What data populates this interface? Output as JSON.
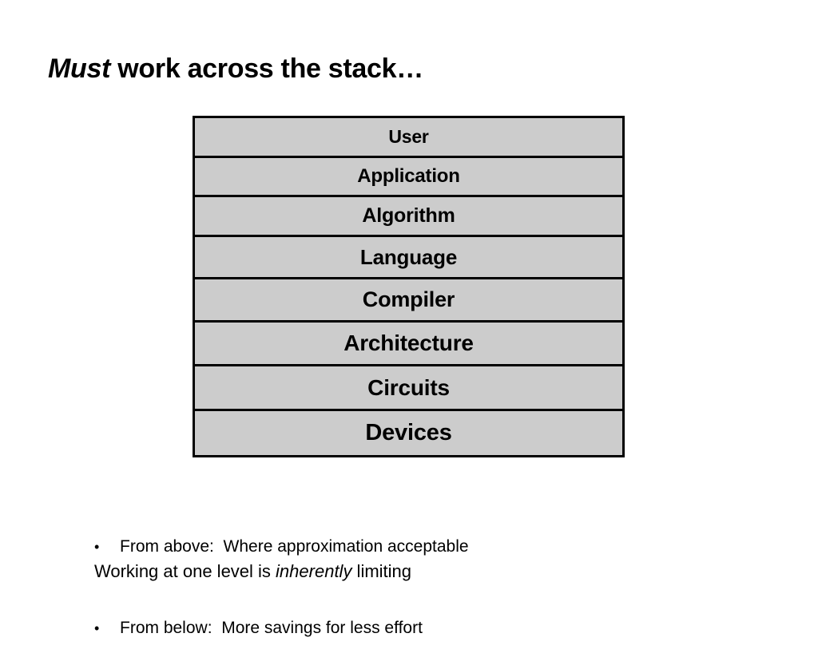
{
  "slide": {
    "title": {
      "emphasis": "Must",
      "rest": " work across the stack…"
    },
    "colors": {
      "background": "#ffffff",
      "text": "#000000",
      "layer_fill": "#cccccc",
      "layer_border": "#000000"
    }
  },
  "stack": {
    "name": "computing-stack",
    "layers": [
      {
        "label": "User"
      },
      {
        "label": "Application"
      },
      {
        "label": "Algorithm"
      },
      {
        "label": "Language"
      },
      {
        "label": "Compiler"
      },
      {
        "label": "Architecture"
      },
      {
        "label": "Circuits"
      },
      {
        "label": "Devices"
      }
    ]
  },
  "bullets": {
    "marker": "•",
    "items": [
      {
        "text": "From above:  Where approximation acceptable"
      },
      {
        "text": "From below:  More savings for less effort"
      }
    ]
  },
  "footer": {
    "before": "Working at one level is ",
    "emphasis": "inherently",
    "after": " limiting"
  }
}
